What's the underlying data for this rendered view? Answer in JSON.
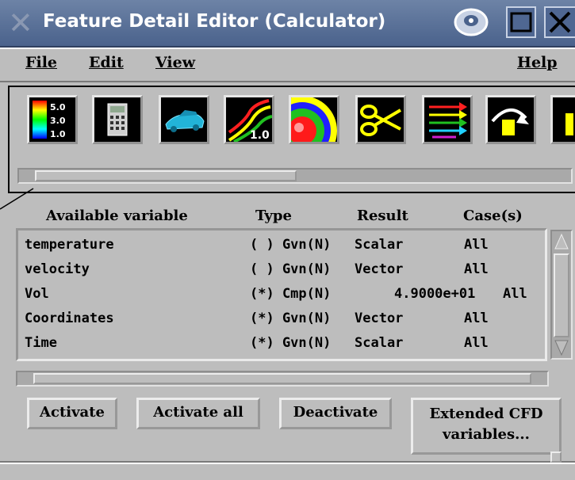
{
  "window": {
    "title": "Feature Detail Editor (Calculator)",
    "icons": [
      "x-logo-icon",
      "minimize-icon",
      "maximize-icon",
      "close-icon"
    ]
  },
  "menubar": {
    "file": "File",
    "edit": "Edit",
    "view": "View",
    "help": "Help"
  },
  "toolbar": {
    "tools": [
      {
        "name": "color-legend-tool-icon",
        "labels": [
          "5.0",
          "3.0",
          "1.0"
        ]
      },
      {
        "name": "calculator-tool-icon"
      },
      {
        "name": "car-model-tool-icon"
      },
      {
        "name": "contour-tool-icon",
        "labels": [
          "1.0"
        ]
      },
      {
        "name": "isosurface-tool-icon"
      },
      {
        "name": "scissors-clip-tool-icon"
      },
      {
        "name": "vector-arrows-tool-icon"
      },
      {
        "name": "elevated-surface-tool-icon"
      }
    ]
  },
  "variables": {
    "headers": {
      "name": "Available variable",
      "type": "Type",
      "result": "Result",
      "cases": "Case(s)"
    },
    "rows": [
      {
        "name": "temperature",
        "type": "( ) Gvn(N)",
        "result": "Scalar",
        "cases": "All"
      },
      {
        "name": "velocity",
        "type": "( ) Gvn(N)",
        "result": "Vector",
        "cases": "All"
      },
      {
        "name": "Vol",
        "type": "(*) Cmp(N)",
        "result": "4.9000e+01",
        "cases": "All"
      },
      {
        "name": "Coordinates",
        "type": "(*) Gvn(N)",
        "result": "Vector",
        "cases": "All"
      },
      {
        "name": "Time",
        "type": "(*) Gvn(N)",
        "result": "Scalar",
        "cases": "All"
      }
    ]
  },
  "buttons": {
    "activate": "Activate",
    "activate_all": "Activate all",
    "deactivate": "Deactivate",
    "extended_line1": "Extended CFD",
    "extended_line2": "variables..."
  },
  "colors": {
    "titlebar": "#4a628c",
    "panel": "#bdbdbd",
    "text": "#000000"
  }
}
